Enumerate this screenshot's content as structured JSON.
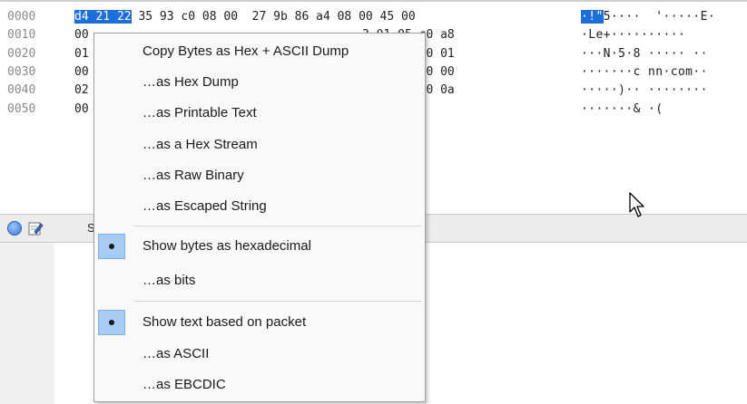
{
  "hex_dump": {
    "rows": [
      {
        "offset": "0000",
        "sel": "d4 21 22",
        "bytes_a": " 35 93 c0 08 00  27 9b 86 a4 08 00 45 00",
        "bytes_b": "",
        "ascii_sel": "·!\"",
        "ascii": "5····  '·····E·"
      },
      {
        "offset": "0010",
        "sel": "",
        "bytes_a": "00",
        "bytes_b": "3 01 05 c0 a8",
        "ascii_sel": "",
        "ascii": "·Le+··········"
      },
      {
        "offset": "0020",
        "sel": "",
        "bytes_a": "01",
        "bytes_b": "9 01 20 00 01",
        "ascii_sel": "",
        "ascii": "···N·5·8 ····· ··"
      },
      {
        "offset": "0030",
        "sel": "",
        "bytes_a": "00",
        "bytes_b": "3 6f 6d 00 00",
        "ascii_sel": "",
        "ascii": "·······c nn·com··"
      },
      {
        "offset": "0040",
        "sel": "",
        "bytes_a": "02",
        "bytes_b": "0 00 0c 00 0a",
        "ascii_sel": "",
        "ascii": "·····)·· ········"
      },
      {
        "offset": "0050",
        "sel": "",
        "bytes_a": "00",
        "bytes_b": "",
        "ascii_sel": "",
        "ascii": "·······& ·("
      }
    ]
  },
  "status_bar": {
    "text": "S",
    "expert_icon": "expert-info-icon",
    "edit_icon": "edit-comment-icon"
  },
  "context_menu": {
    "copy_items": [
      "Copy Bytes as Hex + ASCII Dump",
      "…as Hex Dump",
      "…as Printable Text",
      "…as a Hex Stream",
      "…as Raw Binary",
      "…as Escaped String"
    ],
    "bytes_group": [
      {
        "label": "Show bytes as hexadecimal",
        "checked": true
      },
      {
        "label": "…as bits",
        "checked": false
      }
    ],
    "text_group": [
      {
        "label": "Show text based on packet",
        "checked": true
      },
      {
        "label": "…as ASCII",
        "checked": false
      },
      {
        "label": "…as EBCDIC",
        "checked": false
      }
    ]
  },
  "colors": {
    "selection": "#1c6fd9",
    "check_highlight": "#a9cdf2"
  }
}
